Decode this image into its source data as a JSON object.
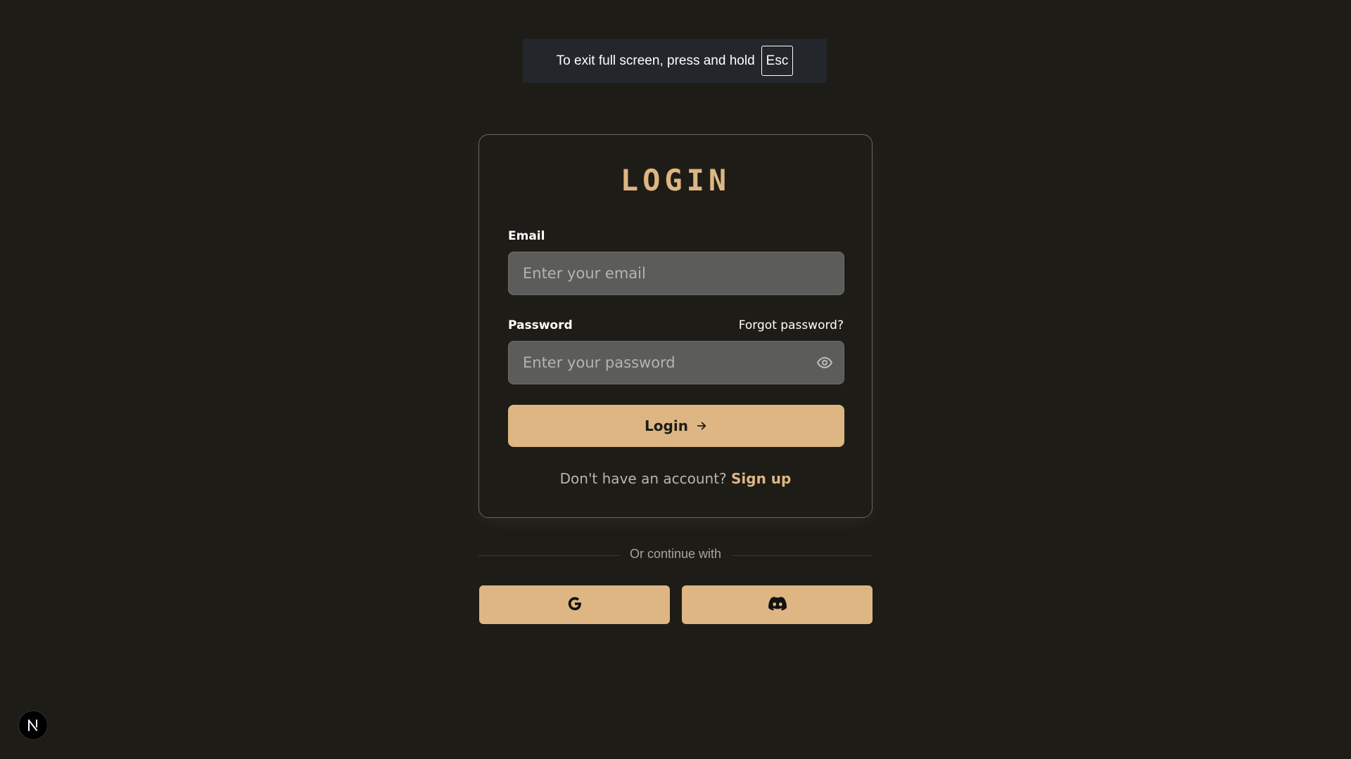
{
  "fullscreen_banner": {
    "text": "To exit full screen, press and hold",
    "key": "Esc"
  },
  "login_card": {
    "title": "LOGIN",
    "email": {
      "label": "Email",
      "placeholder": "Enter your email",
      "value": ""
    },
    "password": {
      "label": "Password",
      "placeholder": "Enter your password",
      "value": "",
      "toggle_icon": "eye-icon"
    },
    "forgot_password": "Forgot password?",
    "login_button": {
      "label": "Login",
      "icon": "arrow-right-icon"
    },
    "signup_prompt": "Don't have an account?",
    "signup_link": "Sign up"
  },
  "social": {
    "divider_text": "Or continue with",
    "buttons": [
      {
        "provider": "Google",
        "icon": "google-icon"
      },
      {
        "provider": "Discord",
        "icon": "discord-icon"
      }
    ]
  },
  "dev_badge": {
    "icon": "nextjs-n-icon"
  },
  "colors": {
    "background": "#1e1c17",
    "accent": "#deb683",
    "input_bg": "#5c5c5a",
    "card_border": "#6e6658",
    "muted_text": "#b9b5ac"
  }
}
